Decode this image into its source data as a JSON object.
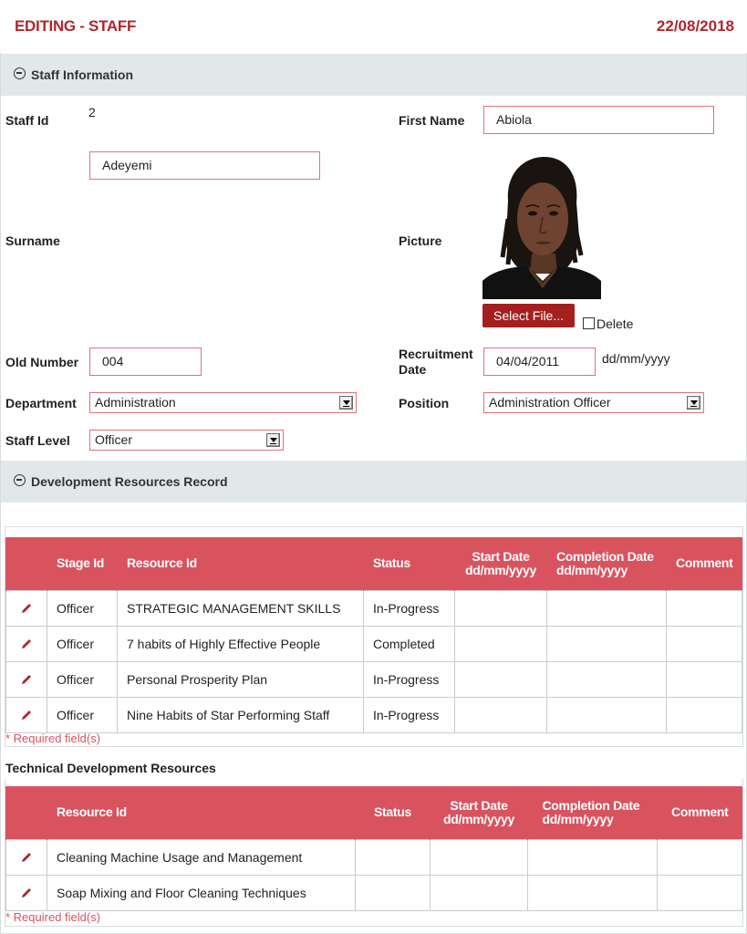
{
  "header": {
    "title": "EDITING - STAFF",
    "date": "22/08/2018"
  },
  "staff_section": {
    "title": "Staff Information",
    "labels": {
      "staff_id": "Staff Id",
      "first_name": "First Name",
      "surname": "Surname",
      "picture": "Picture",
      "old_number": "Old Number",
      "recruitment_date": "Recruitment Date",
      "department": "Department",
      "position": "Position",
      "staff_level": "Staff Level"
    },
    "values": {
      "staff_id": "2",
      "first_name": "Abiola",
      "surname": "Adeyemi",
      "old_number": "004",
      "recruitment_date": "04/04/2011",
      "department": "Administration",
      "position": "Administration Officer",
      "staff_level": "Officer"
    },
    "select_file_label": "Select File...",
    "delete_label": "Delete",
    "date_format": "dd/mm/yyyy"
  },
  "dev_section": {
    "title": "Development Resources Record",
    "columns": [
      "",
      "Stage Id",
      "Resource Id",
      "Status",
      "Start Date dd/mm/yyyy",
      "Completion Date dd/mm/yyyy",
      "Comment"
    ],
    "rows": [
      {
        "stage": "Officer",
        "resource": "STRATEGIC MANAGEMENT SKILLS",
        "status": "In-Progress",
        "start": "",
        "completion": "",
        "comment": ""
      },
      {
        "stage": "Officer",
        "resource": "7 habits of Highly Effective People",
        "status": "Completed",
        "start": "",
        "completion": "",
        "comment": ""
      },
      {
        "stage": "Officer",
        "resource": "Personal Prosperity Plan",
        "status": "In-Progress",
        "start": "",
        "completion": "",
        "comment": ""
      },
      {
        "stage": "Officer",
        "resource": "Nine Habits of Star Performing Staff",
        "status": "In-Progress",
        "start": "",
        "completion": "",
        "comment": ""
      }
    ],
    "required_note": "* Required field(s)"
  },
  "tech_section": {
    "title": "Technical Development Resources",
    "columns": [
      "",
      "Resource Id",
      "Status",
      "Start Date dd/mm/yyyy",
      "Completion Date dd/mm/yyyy",
      "Comment"
    ],
    "rows": [
      {
        "resource": "Cleaning Machine Usage and Management",
        "status": "",
        "start": "",
        "completion": "",
        "comment": ""
      },
      {
        "resource": "Soap Mixing and Floor Cleaning Techniques",
        "status": "",
        "start": "",
        "completion": "",
        "comment": ""
      }
    ],
    "required_note": "* Required field(s)"
  },
  "icons": {
    "collapse": "minus-circle-icon",
    "edit": "pencil-icon"
  },
  "colors": {
    "accent": "#b0262c",
    "table_header": "#d9535f",
    "section_bg": "#e2e8e9",
    "field_border": "#e0707a",
    "button": "#a3201f"
  }
}
